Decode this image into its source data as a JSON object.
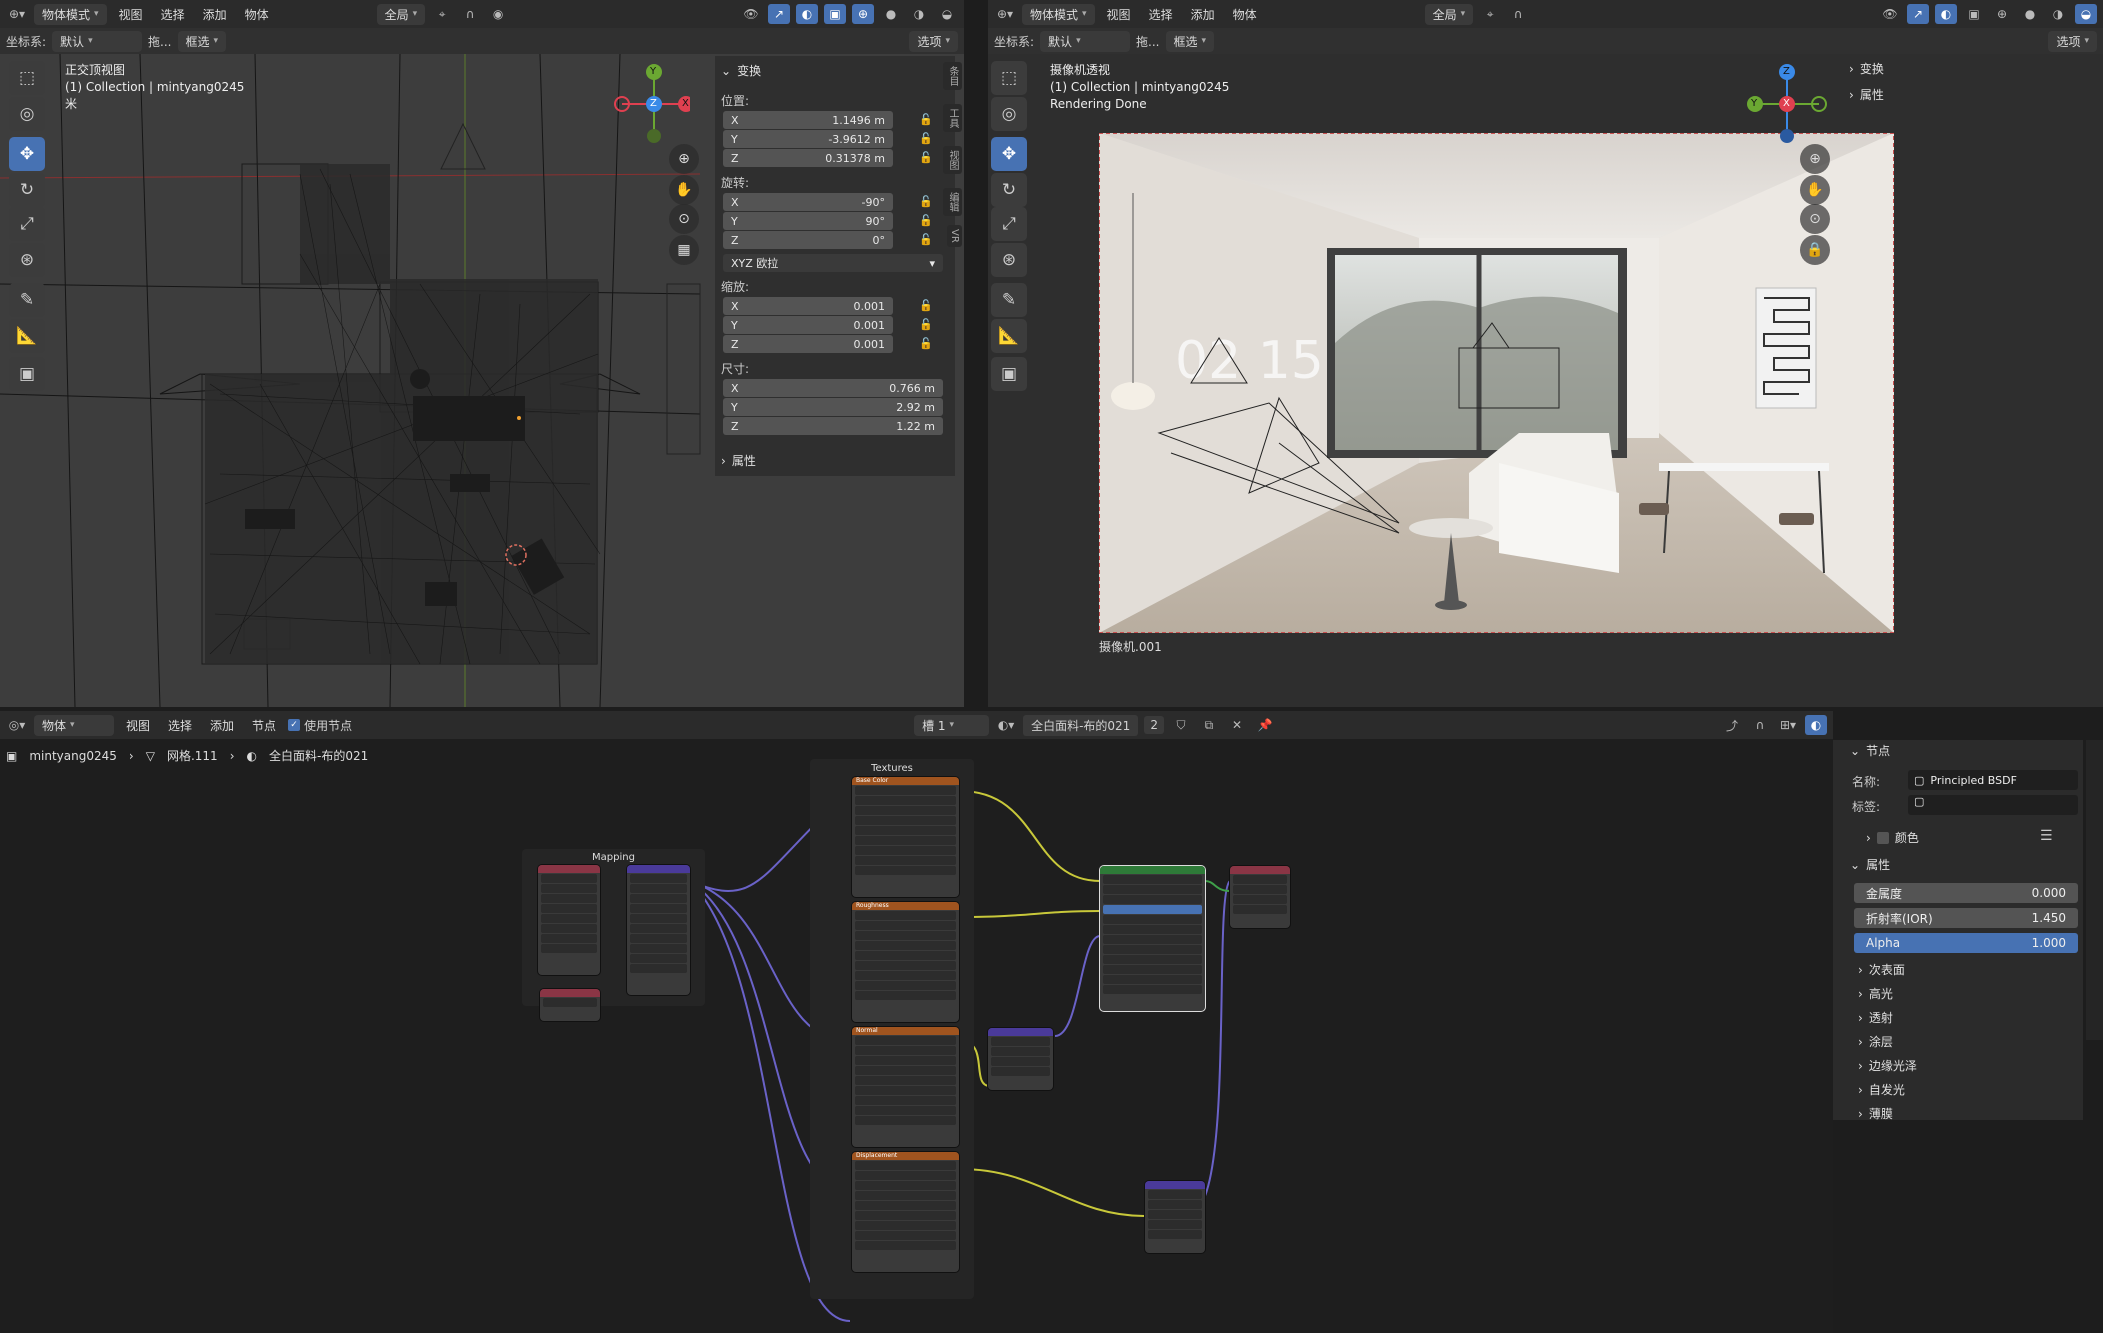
{
  "left_view": {
    "mode": "物体模式",
    "menus": [
      "视图",
      "选择",
      "添加",
      "物体"
    ],
    "orientation_label": "坐标系:",
    "orientation_value": "默认",
    "drag_label": "拖...",
    "select_value": "框选",
    "pivot": "全局",
    "options": "选项",
    "overlay_title": "正交顶视图",
    "overlay_collection": "(1) Collection | mintyang0245",
    "overlay_unit": "米",
    "gizmo": {
      "y": "Y",
      "z": "Z",
      "x": "X"
    }
  },
  "transform_panel": {
    "title": "变换",
    "location_label": "位置:",
    "location": [
      {
        "axis": "X",
        "value": "1.1496 m"
      },
      {
        "axis": "Y",
        "value": "-3.9612 m"
      },
      {
        "axis": "Z",
        "value": "0.31378 m"
      }
    ],
    "rotation_label": "旋转:",
    "rotation": [
      {
        "axis": "X",
        "value": "-90°"
      },
      {
        "axis": "Y",
        "value": "90°"
      },
      {
        "axis": "Z",
        "value": "0°"
      }
    ],
    "rotation_mode": "XYZ 欧拉",
    "scale_label": "缩放:",
    "scale": [
      {
        "axis": "X",
        "value": "0.001"
      },
      {
        "axis": "Y",
        "value": "0.001"
      },
      {
        "axis": "Z",
        "value": "0.001"
      }
    ],
    "dimensions_label": "尺寸:",
    "dimensions": [
      {
        "axis": "X",
        "value": "0.766 m"
      },
      {
        "axis": "Y",
        "value": "2.92 m"
      },
      {
        "axis": "Z",
        "value": "1.22 m"
      }
    ],
    "properties": "属性",
    "side_tabs": [
      "条目",
      "工具",
      "视图",
      "编辑",
      "VR"
    ]
  },
  "right_view": {
    "mode": "物体模式",
    "menus": [
      "视图",
      "选择",
      "添加",
      "物体"
    ],
    "orientation_label": "坐标系:",
    "orientation_value": "默认",
    "drag_label": "拖...",
    "select_value": "框选",
    "pivot": "全局",
    "options": "选项",
    "overlay_title": "摄像机透视",
    "overlay_collection": "(1) Collection | mintyang0245",
    "overlay_status": "Rendering Done",
    "camera_name": "摄像机.001",
    "render_wall_text": "02 15",
    "n_panel": [
      "变换",
      "属性"
    ],
    "gizmo": {
      "y": "Y",
      "z": "Z",
      "x": "X"
    }
  },
  "node_editor": {
    "type": "物体",
    "menus": [
      "视图",
      "选择",
      "添加",
      "节点"
    ],
    "use_nodes_label": "使用节点",
    "slot": "槽 1",
    "material": "全白面料-布的021",
    "users": "2",
    "breadcrumb": [
      "mintyang0245",
      "网格.111",
      "全白面料-布的021"
    ],
    "frame_mapping": "Mapping",
    "frame_textures": "Textures",
    "texture_nodes": [
      "Base Color",
      "Roughness",
      "Normal",
      "Displacement"
    ]
  },
  "node_panel": {
    "section_node": "节点",
    "name_label": "名称:",
    "name_value": "Principled BSDF",
    "label_label": "标签:",
    "color_label": "颜色",
    "section_props": "属性",
    "metallic_label": "金属度",
    "metallic_value": "0.000",
    "ior_label": "折射率(IOR)",
    "ior_value": "1.450",
    "alpha_label": "Alpha",
    "alpha_value": "1.000",
    "subsections": [
      "次表面",
      "高光",
      "透射",
      "涂层",
      "边缘光泽",
      "自发光",
      "薄膜"
    ]
  },
  "colors": {
    "accent": "#4772b3",
    "header": "#2b2b2b",
    "area": "#303030"
  }
}
